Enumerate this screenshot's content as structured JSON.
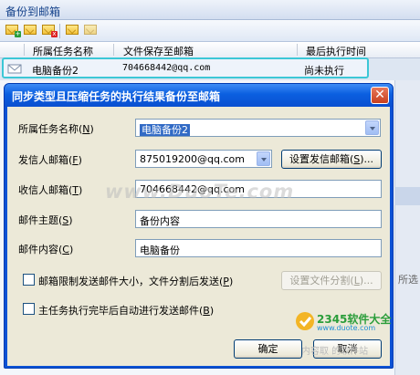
{
  "background_window": {
    "title": "备份到邮箱",
    "columns": [
      "所属任务名称",
      "文件保存至邮箱",
      "最后执行时间"
    ],
    "row": {
      "task": "电脑备份2",
      "email": "704668442@qq.com",
      "last_run": "尚未执行"
    },
    "side_text": "所选"
  },
  "dialog": {
    "title": "同步类型且压缩任务的执行结果备份至邮箱",
    "close_glyph": "✕",
    "task_label": "所属任务名称(",
    "task_key": "N",
    "task_value": "电脑备份2",
    "sender_label": "发信人邮箱(",
    "sender_key": "F",
    "sender_value": "875019200@qq.com",
    "set_sender_button": "设置发信邮箱(",
    "set_sender_key": "S",
    "set_sender_suffix": ")...",
    "recipient_label": "收信人邮箱(",
    "recipient_key": "T",
    "recipient_value": "704668442@qq.com",
    "subject_label": "邮件主题(",
    "subject_key": "S",
    "subject_value": "备份内容",
    "content_label": "邮件内容(",
    "content_key": "C",
    "content_value": "电脑备份",
    "limit_checkbox": "邮箱限制发送邮件大小，文件分割后发送(",
    "limit_key": "P",
    "split_button": "设置文件分割(",
    "split_key": "L",
    "split_suffix": ")...",
    "auto_send_checkbox": "主任务执行完毕后自动进行发送邮件(",
    "auto_send_key": "B",
    "ok_button": "确定",
    "cancel_button": "取消",
    "close_paren": ")"
  },
  "overlay": {
    "watermark": "www.DuoTe.com",
    "logo_brand": "2345软件大全",
    "logo_url": "www.duote.com",
    "footer_text": "内容取 的软件站"
  }
}
